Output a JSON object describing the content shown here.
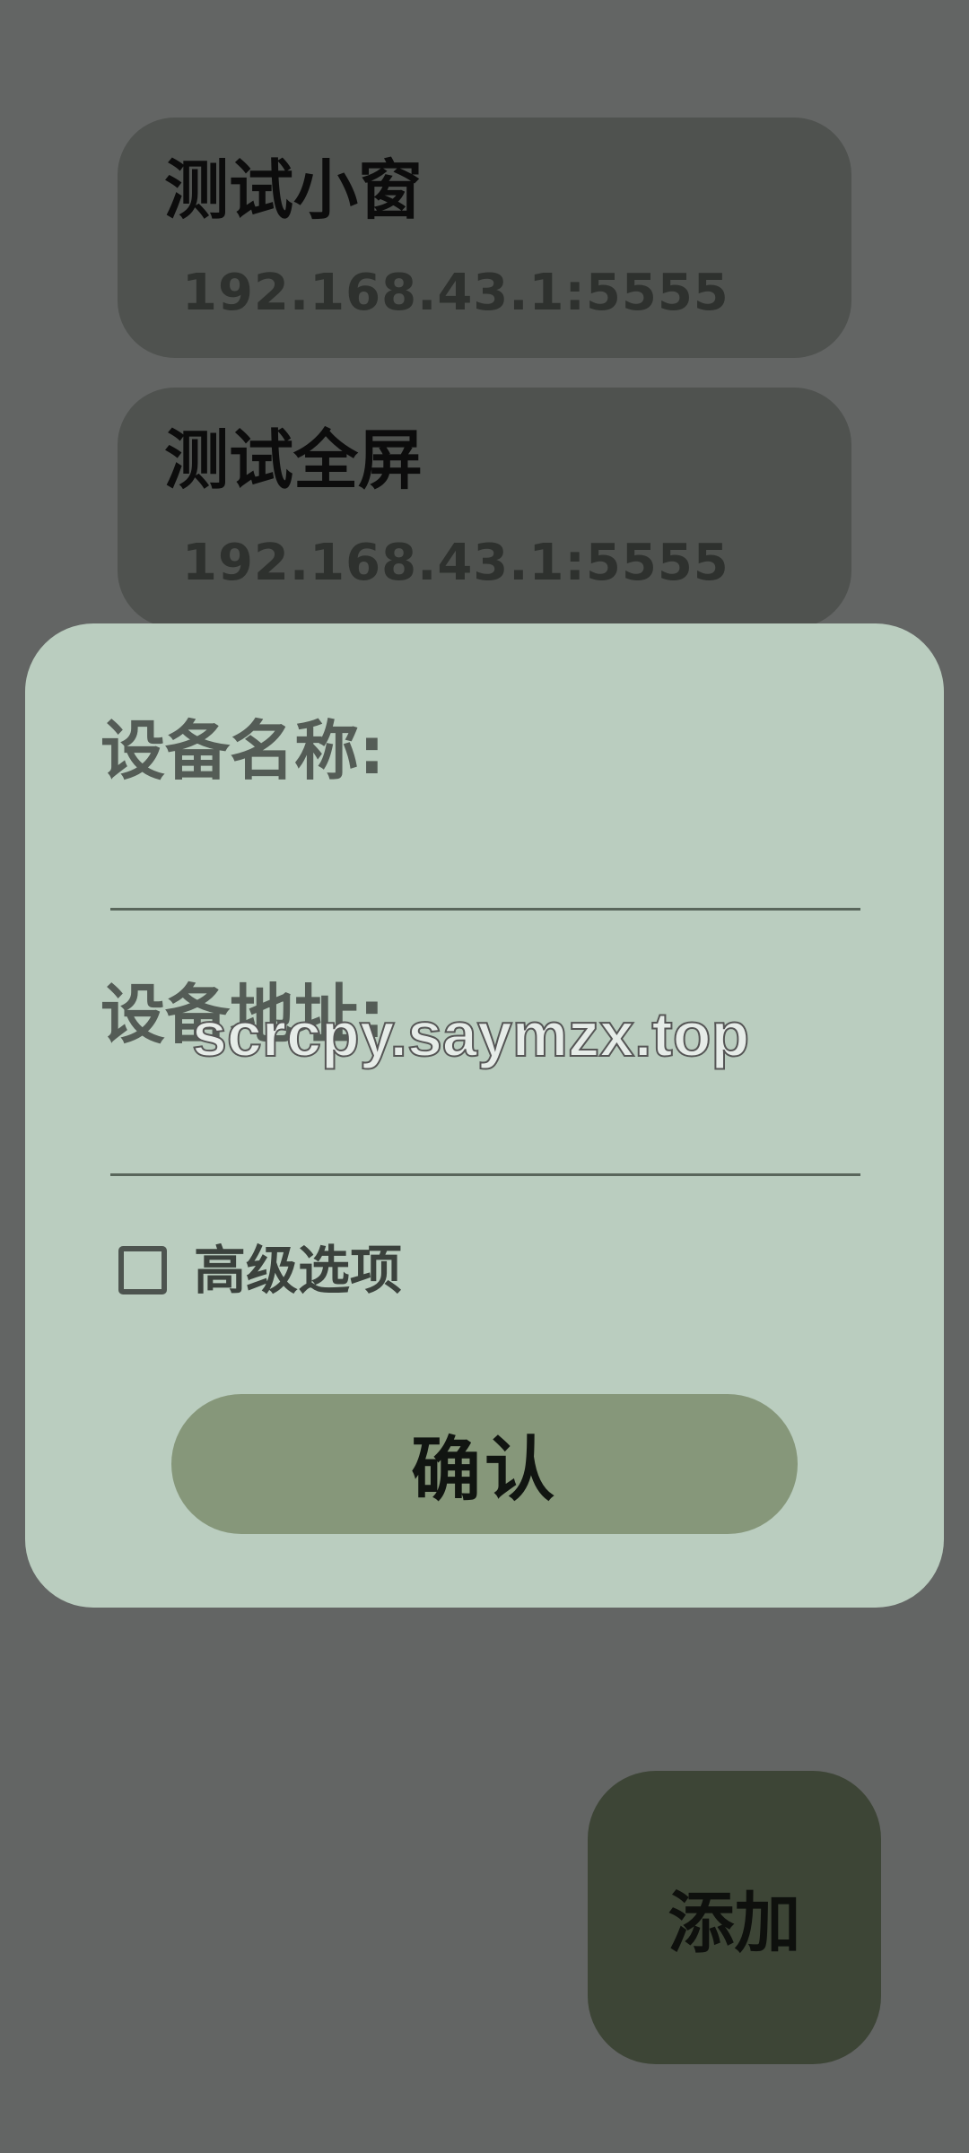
{
  "devices": [
    {
      "name": "测试小窗",
      "address": "192.168.43.1:5555"
    },
    {
      "name": "测试全屏",
      "address": "192.168.43.1:5555"
    }
  ],
  "dialog": {
    "name_label": "设备名称:",
    "name_value": "",
    "address_label": "设备地址:",
    "address_value": "",
    "advanced_label": "高级选项",
    "advanced_checked": false,
    "confirm_label": "确认"
  },
  "watermark": "scrcpy.saymzx.top",
  "add_button": "添加",
  "colors": {
    "background": "#636564",
    "card": "#4f524f",
    "dialog": "#bacdbf",
    "confirm_button": "#86977a",
    "add_button": "#3d4536"
  }
}
